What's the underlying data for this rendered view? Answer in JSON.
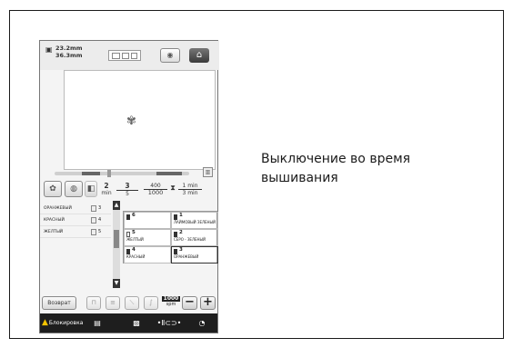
{
  "caption": {
    "line1": "Выключение во время",
    "line2": "вышивания"
  },
  "screen": {
    "topbar": {
      "dim_width": "23.2mm",
      "dim_height": "36.3mm",
      "camera_icon": "camera-icon",
      "home_icon": "home-icon"
    },
    "info": {
      "needle_num": "2",
      "needle_unit": "min",
      "colors_done": "3",
      "colors_total": "5",
      "stitches_done": "400",
      "stitches_total": "1000",
      "time_left": "1 min",
      "time_total": "3 min"
    },
    "color_list": [
      {
        "name": "ОРАНЖЕВЫЙ",
        "num": "3"
      },
      {
        "name": "КРАСНЫЙ",
        "num": "4"
      },
      {
        "name": "ЖЕЛТЫЙ",
        "num": "5"
      }
    ],
    "color_grid": [
      {
        "num": "6",
        "name": ""
      },
      {
        "num": "1",
        "name": "ЛАЙМОВЫЙ ЗЕЛЕНЫЙ"
      },
      {
        "num": "5",
        "name": "ЖЕЛТЫЙ"
      },
      {
        "num": "2",
        "name": "СЕРО - ЗЕЛЕНЫЙ"
      },
      {
        "num": "4",
        "name": "КРАСНЫЙ"
      },
      {
        "num": "3",
        "name": "ОРАНЖЕВЫЙ"
      }
    ],
    "buttons": {
      "back_label": "Возврат",
      "speed_value": "1000",
      "speed_unit": "spm",
      "minus": "−",
      "plus": "+"
    },
    "status": {
      "lock_label": "Блокировка"
    }
  }
}
